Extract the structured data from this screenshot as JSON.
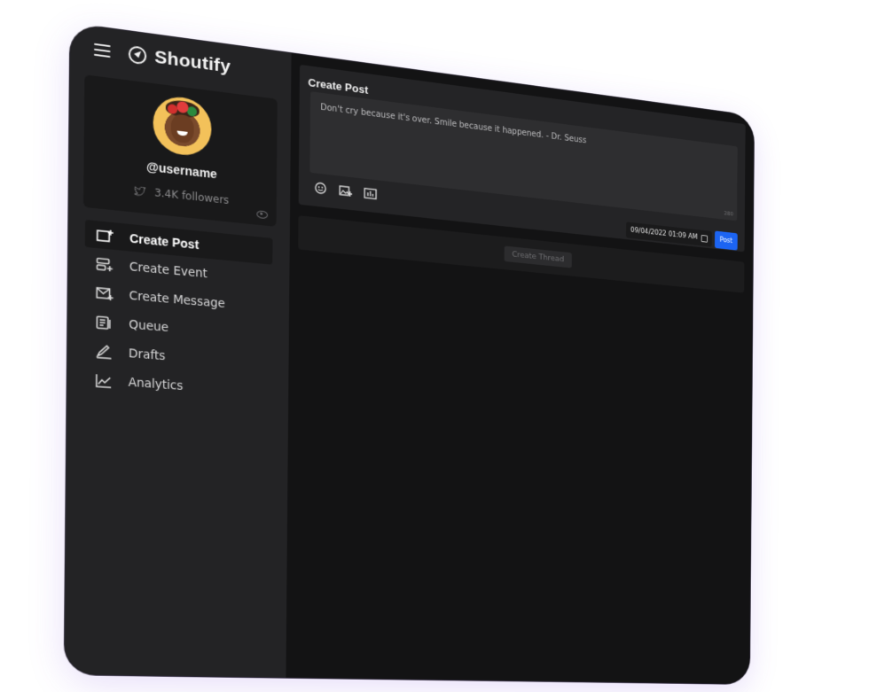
{
  "app": {
    "name": "Shoutify"
  },
  "profile": {
    "username": "@username",
    "followers": "3.4K followers"
  },
  "nav": [
    {
      "label": "Create Post",
      "icon": "create-post-icon",
      "active": true
    },
    {
      "label": "Create Event",
      "icon": "create-event-icon",
      "active": false
    },
    {
      "label": "Create Message",
      "icon": "create-message-icon",
      "active": false
    },
    {
      "label": "Queue",
      "icon": "queue-icon",
      "active": false
    },
    {
      "label": "Drafts",
      "icon": "drafts-icon",
      "active": false
    },
    {
      "label": "Analytics",
      "icon": "analytics-icon",
      "active": false
    }
  ],
  "composer": {
    "title": "Create Post",
    "text": "Don't cry because it's over. Smile because it happened. - Dr. Seuss",
    "char_count": "280",
    "datetime": "09/04/2022 01:09 AM",
    "post_label": "Post"
  },
  "thread": {
    "label": "Create Thread"
  },
  "colors": {
    "accent": "#1c64f2",
    "sidebar": "#232325",
    "main": "#131314"
  }
}
